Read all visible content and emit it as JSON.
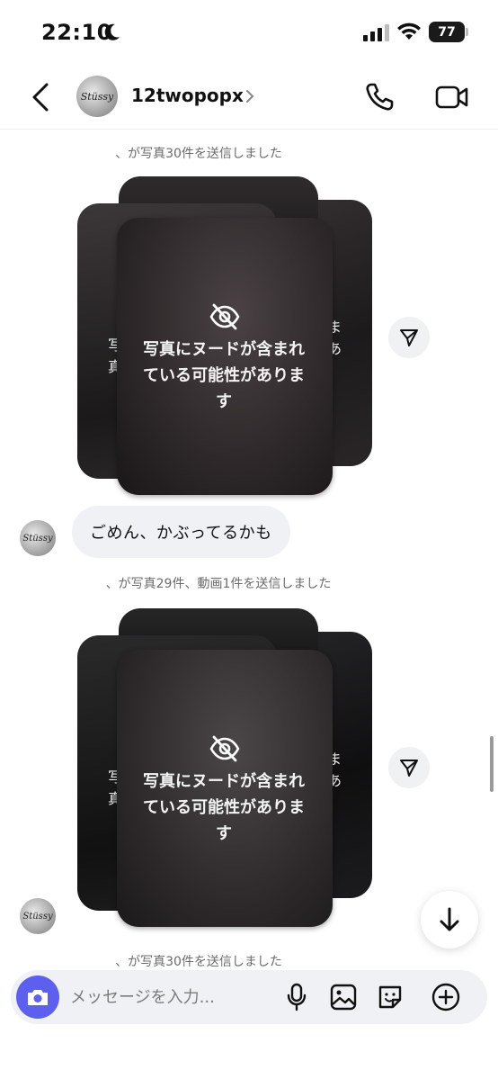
{
  "status_bar": {
    "time": "22:10",
    "battery": "77",
    "icons": [
      "moon-icon",
      "signal-icon",
      "wifi-icon",
      "battery-icon"
    ]
  },
  "header": {
    "username": "12twopopx",
    "avatar_text": "Stüssy",
    "icons": [
      "back-icon",
      "chevron-right-icon",
      "phone-icon",
      "video-icon"
    ]
  },
  "messages": {
    "sys1": "、が写真30件を送信しました",
    "sys2": "、が写真29件、動画1件を送信しました",
    "sys3": "、が写真30件を送信しました",
    "bubble_text": "ごめん、かぶってるかも",
    "stack1": {
      "warning": "写真にヌードが含まれている可能性があります",
      "left_peek": "写\n真",
      "right_peek": "ま\nあ"
    },
    "stack2": {
      "warning": "写真にヌードが含まれている可能性があります",
      "left_peek": "写\n真",
      "right_peek": "ま\nあ"
    }
  },
  "composer": {
    "placeholder": "メッセージを入力...",
    "icons": [
      "camera-icon",
      "mic-icon",
      "gallery-icon",
      "sticker-icon",
      "add-icon"
    ]
  },
  "colors": {
    "accent": "#5d5fef",
    "bubble_bg": "#eff1f4",
    "system_text": "#6b6b6b"
  }
}
